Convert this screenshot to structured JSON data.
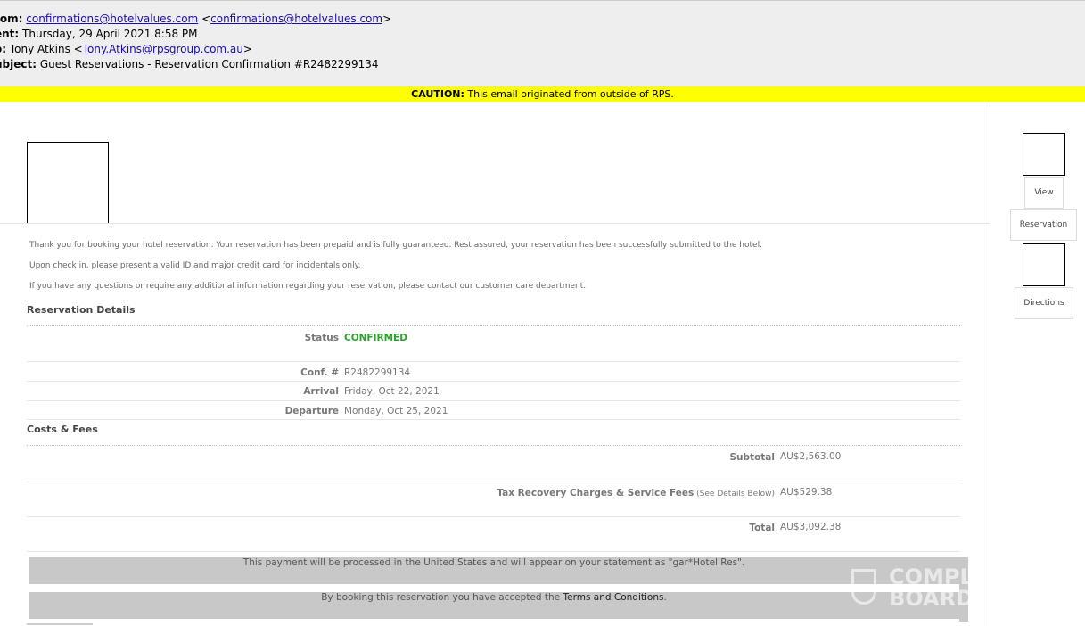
{
  "email_header": {
    "from_label": "rom:",
    "from_email": "confirmations@hotelvalues.com",
    "from_open": " <",
    "from_email2": "confirmations@hotelvalues.com",
    "from_close": ">",
    "sent_label": "ent:",
    "sent_value": " Thursday, 29 April 2021 8:58 PM",
    "to_label": "o:",
    "to_name": " Tony Atkins <",
    "to_email": "Tony.Atkins@rpsgroup.com.au",
    "to_close": ">",
    "subject_label": "ubject:",
    "subject_value": " Guest Reservations - Reservation Confirmation #R2482299134"
  },
  "caution": {
    "label": "CAUTION:",
    "text": " This email originated from outside of RPS."
  },
  "intro": {
    "p1": "Thank you for booking your hotel reservation. Your reservation has been prepaid and is fully guaranteed. Rest assured, your reservation has been successfully submitted to the hotel.",
    "p2": "Upon check in, please present a valid ID and major credit card for incidentals only.",
    "p3": "If you have any questions or require any additional information regarding your reservation, please contact our customer care department."
  },
  "reservation_details": {
    "title": "Reservation Details",
    "rows": [
      {
        "label": "Status",
        "value": "CONFIRMED"
      },
      {
        "label": "Conf. #",
        "value": "R2482299134"
      },
      {
        "label": "Arrival",
        "value": "Friday, Oct 22, 2021"
      },
      {
        "label": "Departure",
        "value": "Monday, Oct 25, 2021"
      }
    ]
  },
  "costs": {
    "title": "Costs & Fees",
    "subtotal_label": "Subtotal",
    "subtotal_value": "AU$2,563.00",
    "tax_label": "Tax Recovery Charges & Service Fees",
    "tax_note": " (See Details Below)",
    "tax_value": "AU$529.38",
    "total_label": "Total",
    "total_value": "AU$3,092.38"
  },
  "notices": {
    "payment": "This payment will be processed in the United States and will appear on your statement as \"gar*Hotel Res\".",
    "terms_prefix": "By booking this reservation you have accepted the ",
    "terms_link": "Terms and Conditions",
    "terms_suffix": "."
  },
  "sidebar": {
    "view": "View",
    "reservation": "Reservation",
    "directions": "Directions"
  },
  "watermark": {
    "line1": "COMPL",
    "line2": "BOARD"
  },
  "colors": {
    "caution_bg": "#ffff00",
    "confirmed": "#2ea02e",
    "link": "#1a0dab"
  }
}
